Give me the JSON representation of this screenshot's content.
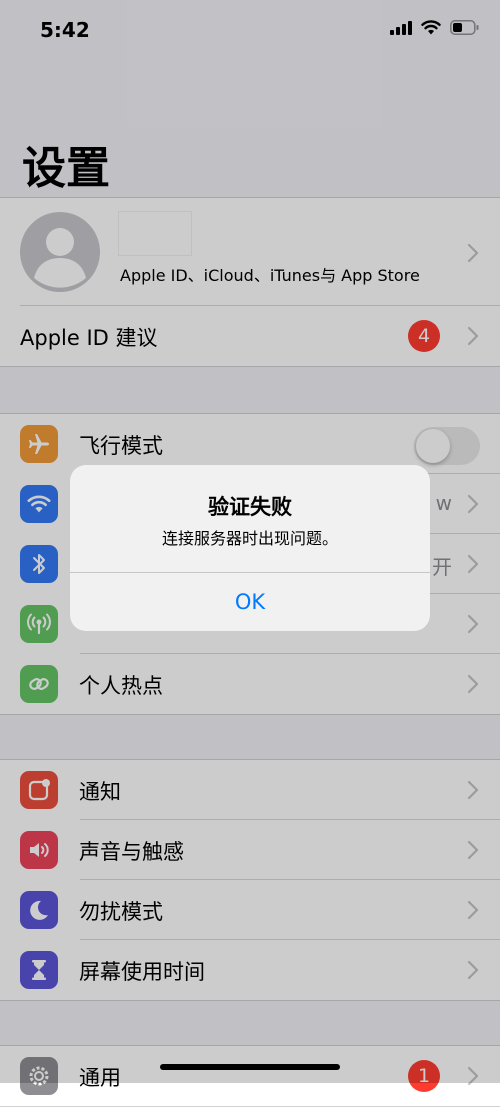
{
  "status_bar": {
    "time": "5:42",
    "icons": [
      "signal-icon",
      "wifi-icon",
      "battery-icon"
    ]
  },
  "header": {
    "title": "设置"
  },
  "profile": {
    "subtitle": "Apple ID、iCloud、iTunes与 App Store"
  },
  "apple_id_suggestion": {
    "label": "Apple ID 建议",
    "badge": "4"
  },
  "connectivity": [
    {
      "label": "飞行模式",
      "icon": "airplane-icon",
      "color": "#f09a37",
      "toggle": false
    },
    {
      "label": "",
      "value": "w",
      "icon": "wifi-icon",
      "color": "#3478f6"
    },
    {
      "label": "",
      "value": "开",
      "icon": "bluetooth-icon",
      "color": "#3478f6"
    },
    {
      "label": "",
      "icon": "cellular-icon",
      "color": "#65c466"
    },
    {
      "label": "个人热点",
      "icon": "hotspot-icon",
      "color": "#65c466"
    }
  ],
  "notifications": [
    {
      "label": "通知",
      "icon": "notification-icon",
      "color": "#eb4e3d"
    },
    {
      "label": "声音与触感",
      "icon": "sound-icon",
      "color": "#eb445a"
    },
    {
      "label": "勿扰模式",
      "icon": "moon-icon",
      "color": "#5b56d7"
    },
    {
      "label": "屏幕使用时间",
      "icon": "hourglass-icon",
      "color": "#5b56d7"
    }
  ],
  "general": {
    "label": "通用",
    "badge": "1",
    "icon": "gear-icon",
    "color": "#8e8e93"
  },
  "alert": {
    "title": "验证失败",
    "message": "连接服务器时出现问题。",
    "button": "OK"
  }
}
